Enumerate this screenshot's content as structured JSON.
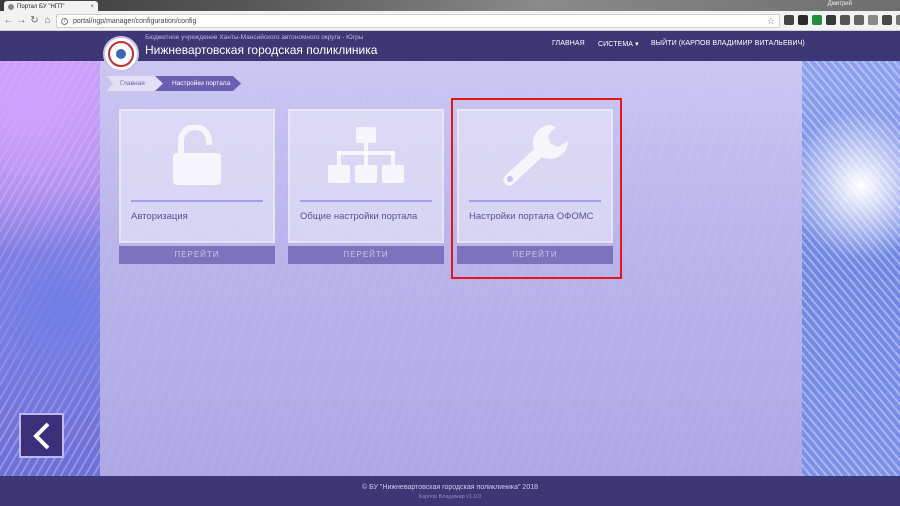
{
  "browser": {
    "tab_title": "Портал БУ \"НГП\"",
    "tab_close": "×",
    "profile_name": "Дмитрий",
    "url": "portal/ngp/manager/configuration/config",
    "back_glyph": "←",
    "forward_glyph": "→",
    "reload_glyph": "↻",
    "home_glyph": "⌂",
    "info_glyph": "i",
    "star_glyph": "☆"
  },
  "header": {
    "subtitle": "Бюджетное учреждение Ханты-Мансийского автономного округа - Югры",
    "title": "Нижневартовская городская поликлиника",
    "nav": {
      "home": "ГЛАВНАЯ",
      "system": "СИСТЕМА ▾",
      "logout": "ВЫЙТИ (КАРПОВ ВЛАДИМИР ВИТАЛЬЕВИЧ)"
    }
  },
  "breadcrumb": {
    "home": "Главная",
    "current": "Настройки портала"
  },
  "cards": [
    {
      "title": "Авторизация",
      "button": "ПЕРЕЙТИ",
      "icon": "unlock-icon"
    },
    {
      "title": "Общие настройки портала",
      "button": "ПЕРЕЙТИ",
      "icon": "sitemap-icon"
    },
    {
      "title": "Настройки портала ОФОМС",
      "button": "ПЕРЕЙТИ",
      "icon": "wrench-icon"
    }
  ],
  "footer": {
    "copyright": "© БУ \"Нижневартовская городская поликлиника\" 2018",
    "user": "Карпов Владимир  v1.0.0"
  },
  "colors": {
    "header_bg": "#3e3775",
    "card_button": "#7d73bc",
    "highlight": "#e3161b"
  }
}
